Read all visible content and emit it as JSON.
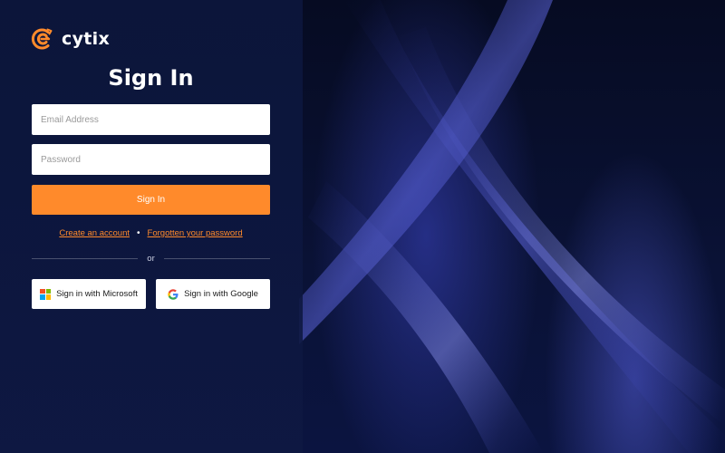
{
  "brand": {
    "name": "cytix",
    "accent_color": "#ff8a2b",
    "logo_icon": "cytix-logo-icon"
  },
  "page": {
    "title": "Sign In"
  },
  "form": {
    "email_placeholder": "Email Address",
    "password_placeholder": "Password",
    "submit_label": "Sign In"
  },
  "links": {
    "create_account": "Create an account",
    "separator": "•",
    "forgot_password": "Forgotten your password"
  },
  "divider": {
    "label": "or"
  },
  "sso": {
    "microsoft_label": "Sign in with Microsoft",
    "microsoft_icon": "microsoft-icon",
    "google_label": "Sign in with Google",
    "google_icon": "google-icon"
  }
}
